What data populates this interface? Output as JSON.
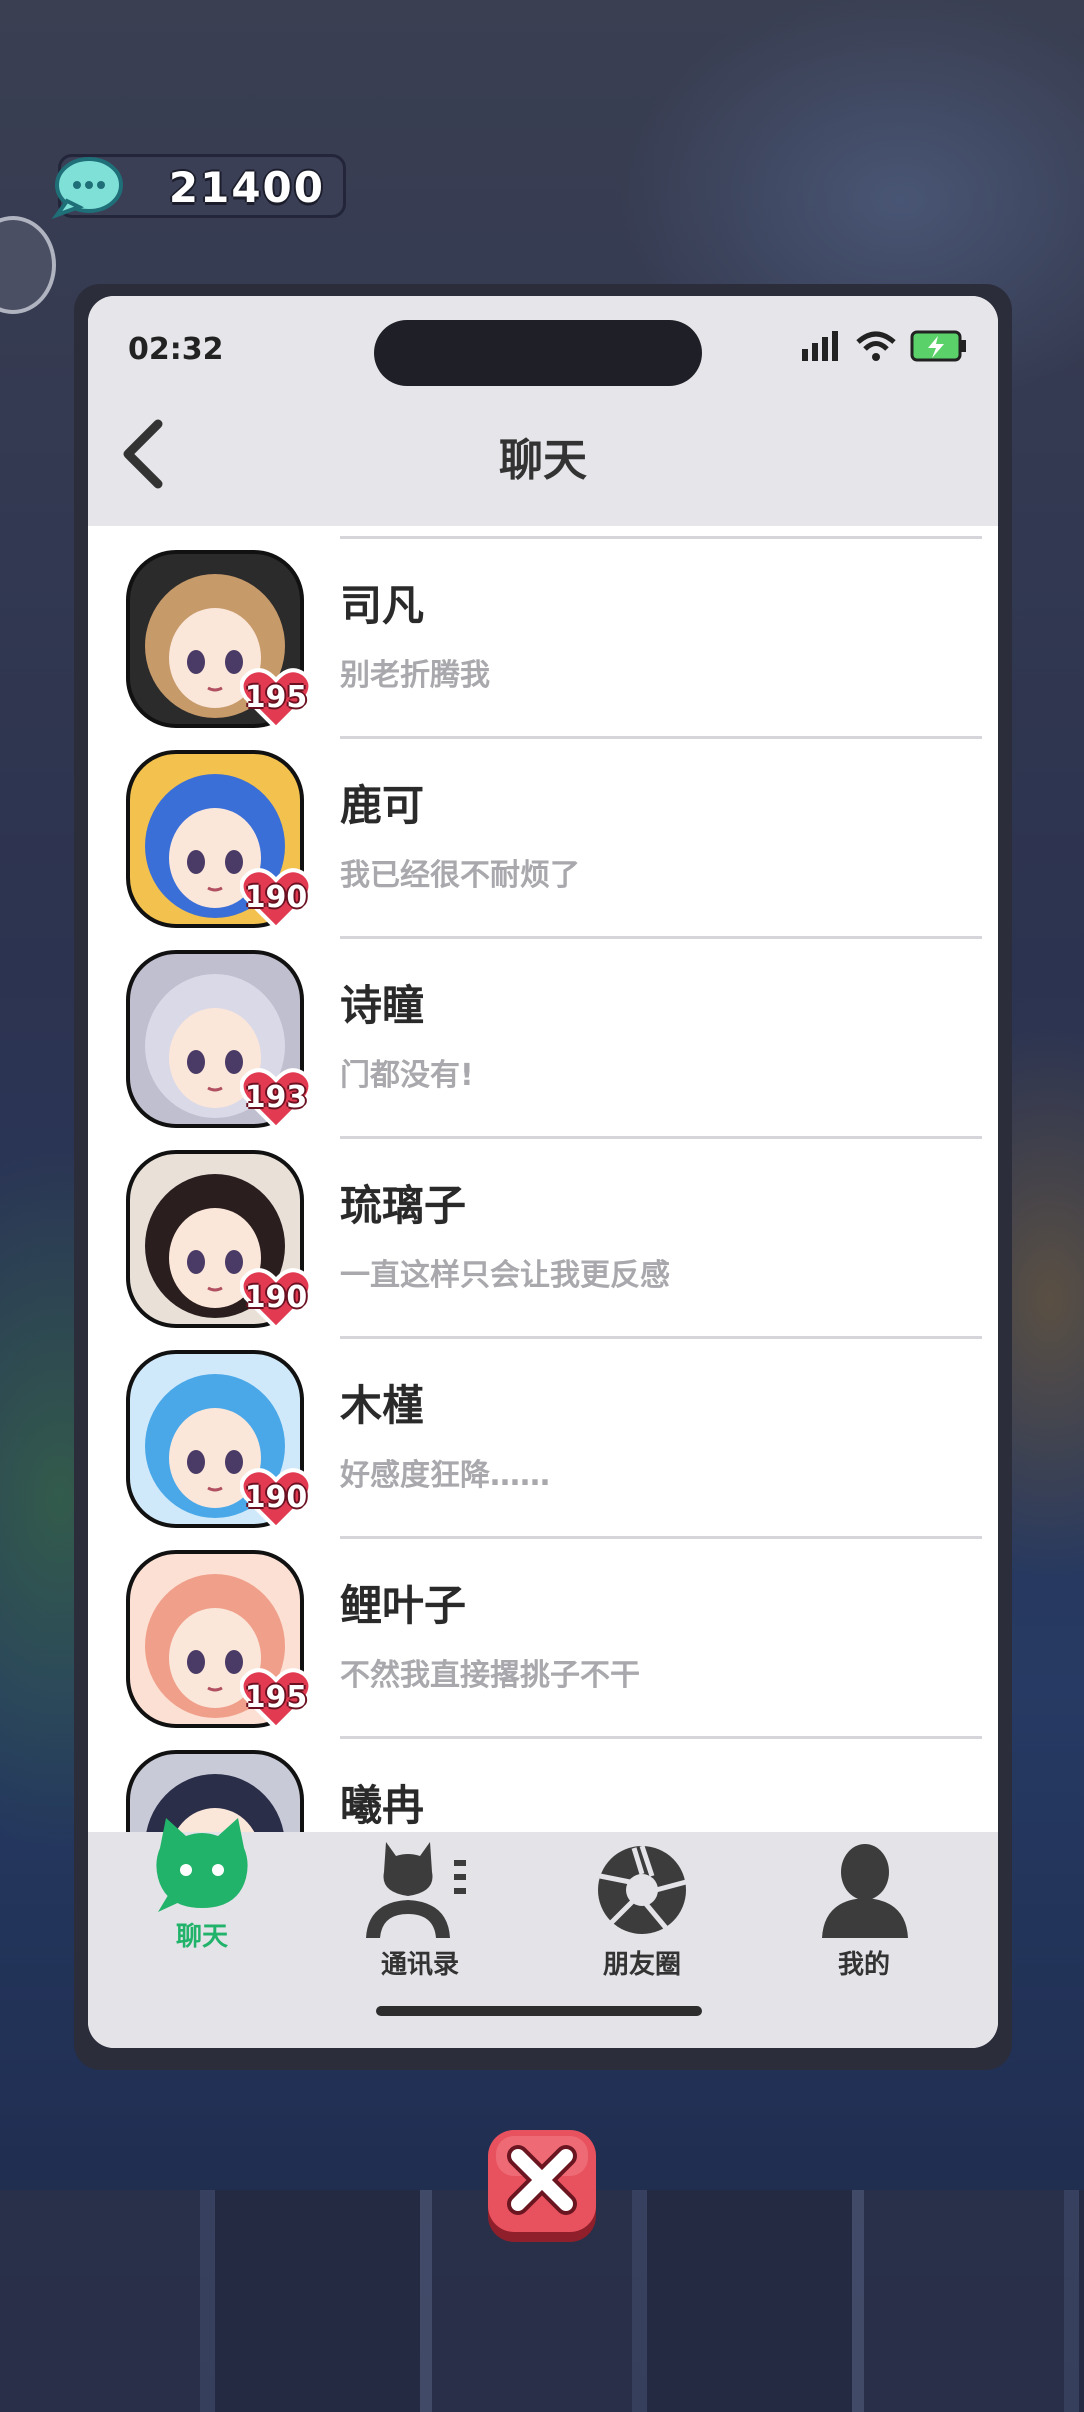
{
  "coins": {
    "value": "21400"
  },
  "status_bar": {
    "time": "02:32"
  },
  "header": {
    "title": "聊天"
  },
  "chats": [
    {
      "name": "司凡",
      "message": "别老折腾我",
      "affection": "195",
      "hair": "#c79a6a",
      "bg": "#2b2b2b"
    },
    {
      "name": "鹿可",
      "message": "我已经很不耐烦了",
      "affection": "190",
      "hair": "#3a6fd8",
      "bg": "#f2c14e"
    },
    {
      "name": "诗瞳",
      "message": "门都没有!",
      "affection": "193",
      "hair": "#d9d9e8",
      "bg": "#bfbfd0"
    },
    {
      "name": "琉璃子",
      "message": "一直这样只会让我更反感",
      "affection": "190",
      "hair": "#2a1e1e",
      "bg": "#e9e0d8"
    },
    {
      "name": "木槿",
      "message": "好感度狂降……",
      "affection": "190",
      "hair": "#4aa8e8",
      "bg": "#cfe9fb"
    },
    {
      "name": "鲤叶子",
      "message": "不然我直接撂挑子不干",
      "affection": "195",
      "hair": "#f0a08a",
      "bg": "#fde0d4"
    },
    {
      "name": "曦冉",
      "message": "",
      "affection": "",
      "hair": "#2a2e48",
      "bg": "#c8cad8"
    }
  ],
  "tabs": [
    {
      "label": "聊天",
      "icon": "chat-cat-icon",
      "active": true
    },
    {
      "label": "通讯录",
      "icon": "contacts-icon",
      "active": false
    },
    {
      "label": "朋友圈",
      "icon": "moments-shutter-icon",
      "active": false
    },
    {
      "label": "我的",
      "icon": "profile-icon",
      "active": false
    }
  ],
  "colors": {
    "accent": "#21b36a",
    "heart": "#e23a50",
    "close": "#e8525e"
  }
}
